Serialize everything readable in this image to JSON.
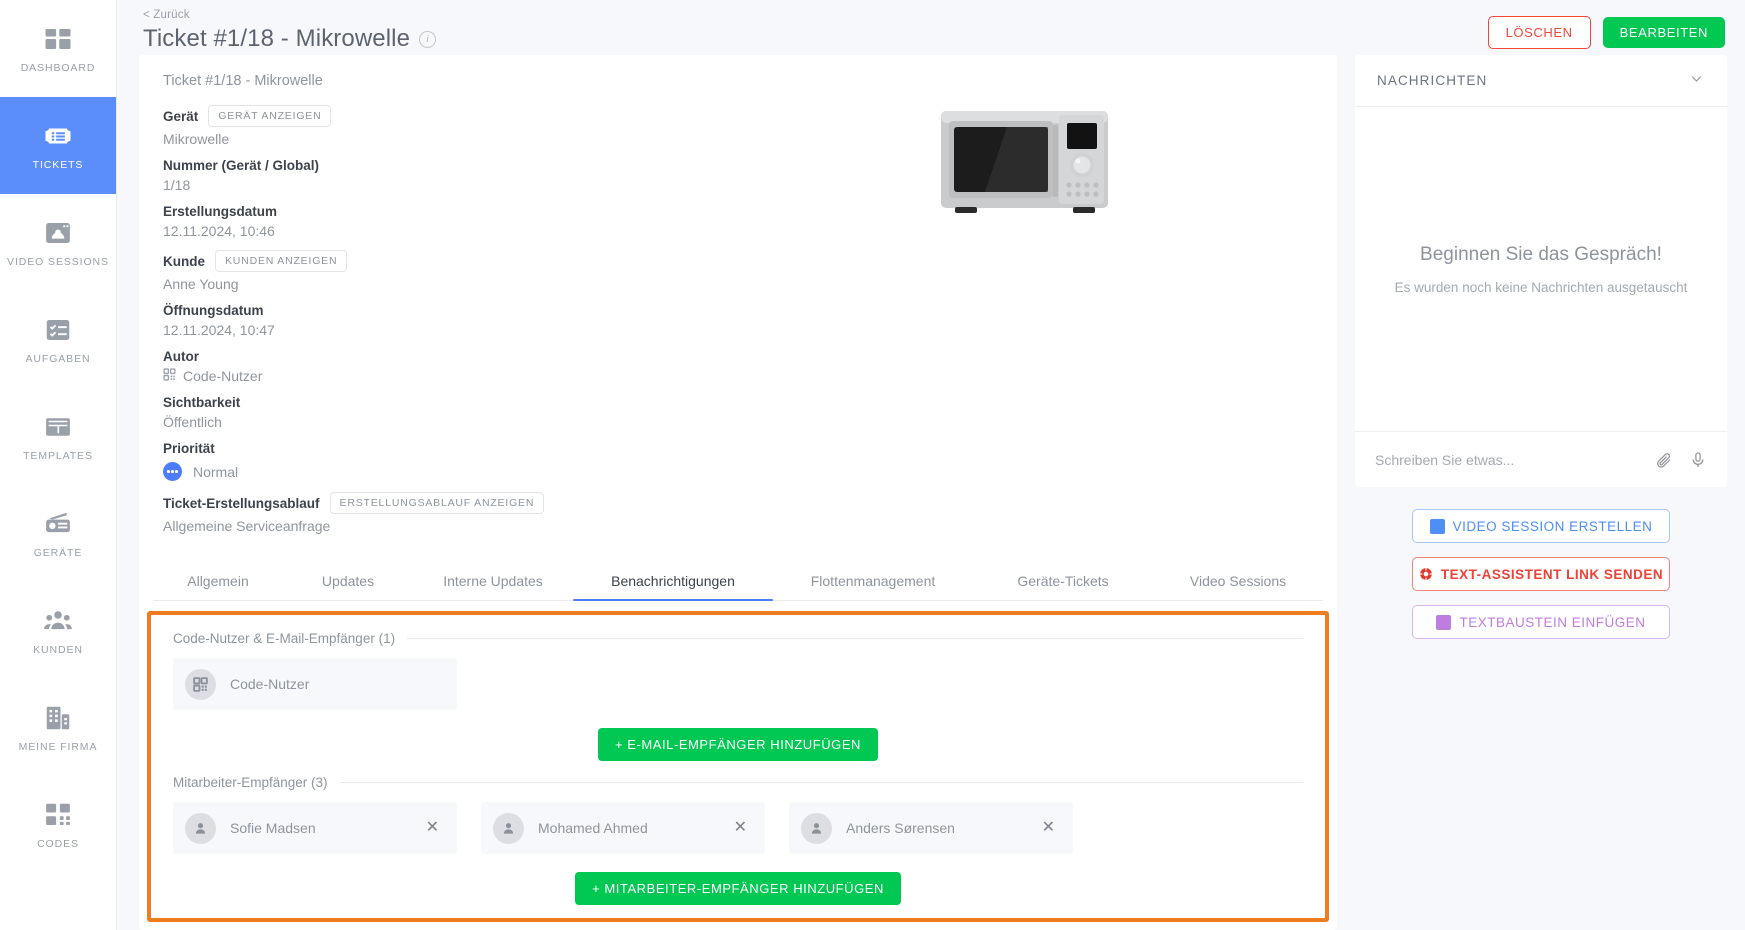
{
  "nav": {
    "items": [
      {
        "label": "DASHBOARD",
        "icon": "dashboard-icon",
        "active": false
      },
      {
        "label": "TICKETS",
        "icon": "ticket-icon",
        "active": true
      },
      {
        "label": "VIDEO SESSIONS",
        "icon": "video-session-icon",
        "active": false
      },
      {
        "label": "AUFGABEN",
        "icon": "tasks-icon",
        "active": false
      },
      {
        "label": "TEMPLATES",
        "icon": "templates-icon",
        "active": false
      },
      {
        "label": "GERÄTE",
        "icon": "device-icon",
        "active": false
      },
      {
        "label": "KUNDEN",
        "icon": "customers-icon",
        "active": false
      },
      {
        "label": "MEINE FIRMA",
        "icon": "company-icon",
        "active": false
      },
      {
        "label": "CODES",
        "icon": "codes-icon",
        "active": false
      }
    ]
  },
  "header": {
    "back_label": "< Zurück",
    "title": "Ticket #1/18 - Mikrowelle",
    "info_glyph": "i",
    "delete_label": "LÖSCHEN",
    "edit_label": "BEARBEITEN"
  },
  "details": {
    "card_title": "Ticket #1/18 - Mikrowelle",
    "fields": [
      {
        "label": "Gerät",
        "chip": "GERÄT ANZEIGEN",
        "value": "Mikrowelle"
      },
      {
        "label": "Nummer (Gerät / Global)",
        "chip": null,
        "value": "1/18"
      },
      {
        "label": "Erstellungsdatum",
        "chip": null,
        "value": "12.11.2024, 10:46"
      },
      {
        "label": "Kunde",
        "chip": "KUNDEN ANZEIGEN",
        "value": "Anne Young"
      },
      {
        "label": "Öffnungsdatum",
        "chip": null,
        "value": "12.11.2024, 10:47"
      },
      {
        "label": "Autor",
        "chip": null,
        "value": "Code-Nutzer"
      },
      {
        "label": "Sichtbarkeit",
        "chip": null,
        "value": "Öffentlich"
      }
    ],
    "priority_label": "Priorität",
    "priority_value": "Normal",
    "priority_color": "#4d7cfe",
    "flow_label": "Ticket-Erstellungsablauf",
    "flow_chip": "ERSTELLUNGSABLAUF ANZEIGEN",
    "flow_value": "Allgemeine Serviceanfrage",
    "device_image_alt": "microwave-product-image"
  },
  "tabs": [
    {
      "label": "Allgemein",
      "active": false
    },
    {
      "label": "Updates",
      "active": false
    },
    {
      "label": "Interne Updates",
      "active": false
    },
    {
      "label": "Benachrichtigungen",
      "active": true
    },
    {
      "label": "Flottenmanagement",
      "active": false
    },
    {
      "label": "Geräte-Tickets",
      "active": false
    },
    {
      "label": "Video Sessions",
      "active": false
    }
  ],
  "notifications": {
    "highlight_color": "#ef7d1e",
    "code_section_title": "Code-Nutzer & E-Mail-Empfänger (1)",
    "code_recipients": [
      {
        "name": "Code-Nutzer",
        "icon": "qr-code-icon",
        "removable": false
      }
    ],
    "add_email_label": "+ E-MAIL-EMPFÄNGER HINZUFÜGEN",
    "employee_section_title": "Mitarbeiter-Empfänger (3)",
    "employee_recipients": [
      {
        "name": "Sofie Madsen",
        "icon": "person-icon",
        "remove": "✕"
      },
      {
        "name": "Mohamed Ahmed",
        "icon": "person-icon",
        "remove": "✕"
      },
      {
        "name": "Anders Sørensen",
        "icon": "person-icon",
        "remove": "✕"
      }
    ],
    "add_employee_label": "+ MITARBEITER-EMPFÄNGER HINZUFÜGEN"
  },
  "messages": {
    "panel_title": "NACHRICHTEN",
    "empty_title": "Beginnen Sie das Gespräch!",
    "empty_subtitle": "Es wurden noch keine Nachrichten ausgetauscht",
    "input_placeholder": "Schreiben Sie etwas...",
    "input_value": "",
    "actions": [
      {
        "label": "VIDEO SESSION ERSTELLEN",
        "style": "blue",
        "icon": "video-session-icon"
      },
      {
        "label": "TEXT-ASSISTENT LINK SENDEN",
        "style": "red",
        "icon": "life-ring-icon"
      },
      {
        "label": "TEXTBAUSTEIN EINFÜGEN",
        "style": "purple",
        "icon": "grid-icon"
      }
    ]
  }
}
